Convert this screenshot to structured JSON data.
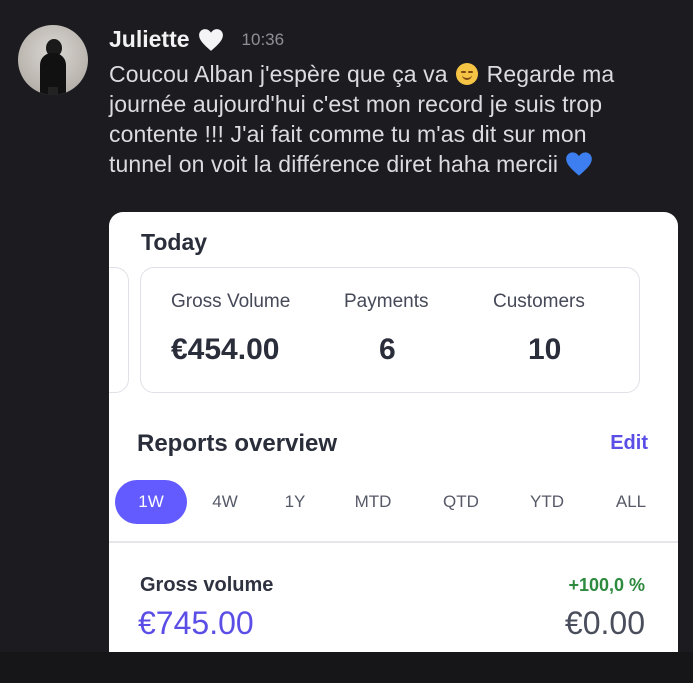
{
  "message": {
    "username": "Juliette",
    "timestamp": "10:36",
    "line1_before_emoji": "Coucou Alban j'espère que ça va ",
    "line1_after_emoji": " Regarde ma",
    "line2": "journée aujourd'hui c'est mon record je suis trop",
    "line3": "contente !!! J'ai fait comme tu m'as dit sur mon",
    "line4": "tunnel on voit la différence diret haha mercii ",
    "icons": [
      "white-heart-icon",
      "smiling-face-icon",
      "blue-heart-icon"
    ]
  },
  "card": {
    "today_title": "Today",
    "stats": {
      "gross_volume_label": "Gross Volume",
      "gross_volume_value": "€454.00",
      "payments_label": "Payments",
      "payments_value": "6",
      "customers_label": "Customers",
      "customers_value": "10"
    },
    "reports_title": "Reports overview",
    "edit_label": "Edit",
    "tabs": [
      "1W",
      "4W",
      "1Y",
      "MTD",
      "QTD",
      "YTD",
      "ALL"
    ],
    "active_tab": "1W",
    "gross_volume": {
      "label": "Gross volume",
      "change": "+100,0 %",
      "value": "€745.00",
      "previous_value": "€0.00"
    }
  },
  "colors": {
    "accent": "#635bff",
    "positive": "#2e8a3e",
    "background": "#1c1c20",
    "blue_heart": "#3d7ff0"
  }
}
